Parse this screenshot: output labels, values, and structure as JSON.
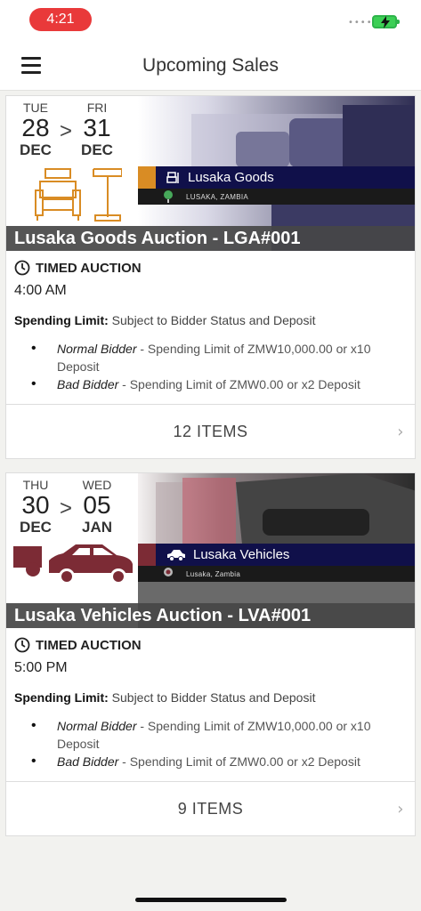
{
  "status_bar": {
    "time": "4:21",
    "signal_dots": "••••"
  },
  "nav": {
    "title": "Upcoming Sales"
  },
  "colors": {
    "goods_accent": "#d98c24",
    "vehicles_accent": "#7c2b35",
    "time_pill": "#e9393a"
  },
  "auctions": [
    {
      "start_dow": "TUE",
      "start_day": "28",
      "start_month": "DEC",
      "separator": ">",
      "end_dow": "FRI",
      "end_day": "31",
      "end_month": "DEC",
      "category_icon": "furniture-icon",
      "tag_title": "Lusaka Goods",
      "tag_location": "LUSAKA, ZAMBIA",
      "title": "Lusaka Goods Auction - LGA#001",
      "type": "TIMED AUCTION",
      "start_time": "4:00 AM",
      "spending_limit_label": "Spending Limit:",
      "spending_limit_text": "Subject to Bidder Status and Deposit",
      "bidders": [
        {
          "name": "Normal Bidder",
          "text": "- Spending Limit of ZMW10,000.00 or x10 Deposit"
        },
        {
          "name": "Bad Bidder",
          "text": "- Spending Limit of ZMW0.00 or x2 Deposit"
        }
      ],
      "items_label": "12 ITEMS"
    },
    {
      "start_dow": "THU",
      "start_day": "30",
      "start_month": "DEC",
      "separator": ">",
      "end_dow": "WED",
      "end_day": "05",
      "end_month": "JAN",
      "category_icon": "vehicle-icon",
      "tag_title": "Lusaka Vehicles",
      "tag_location": "Lusaka, Zambia",
      "title": "Lusaka Vehicles Auction - LVA#001",
      "type": "TIMED AUCTION",
      "start_time": "5:00 PM",
      "spending_limit_label": "Spending Limit:",
      "spending_limit_text": "Subject to Bidder Status and Deposit",
      "bidders": [
        {
          "name": "Normal Bidder",
          "text": "- Spending Limit of ZMW10,000.00 or x10 Deposit"
        },
        {
          "name": "Bad Bidder",
          "text": "- Spending Limit of ZMW0.00 or x2 Deposit"
        }
      ],
      "items_label": "9 ITEMS"
    }
  ]
}
